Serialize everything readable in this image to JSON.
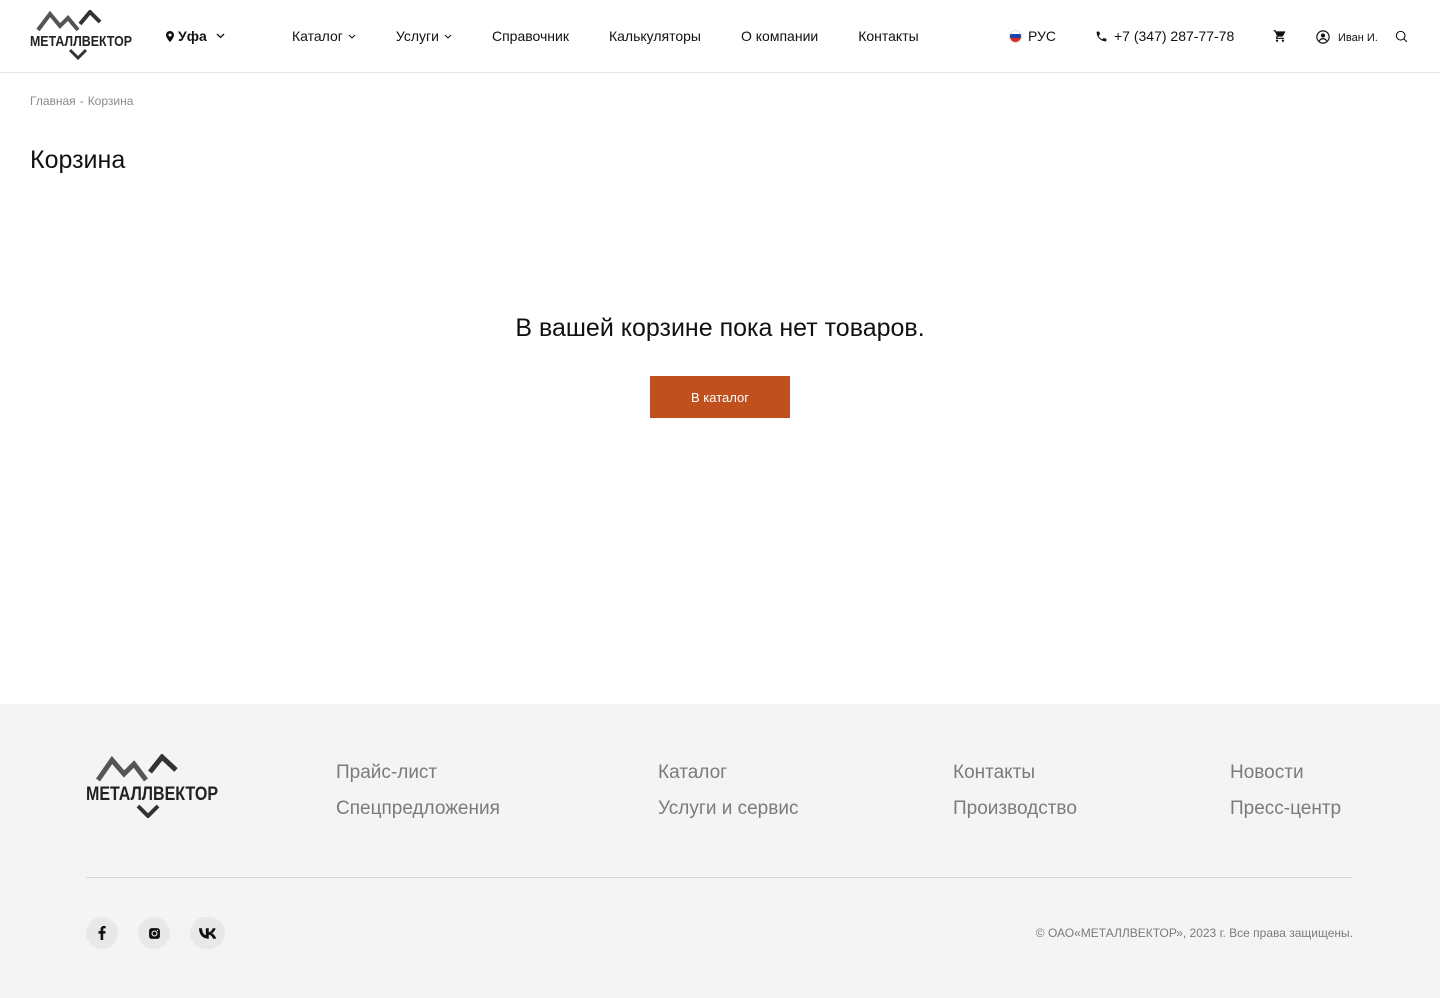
{
  "header": {
    "logo_text": "МЕТАЛЛВЕКТОР",
    "city": "Уфа",
    "nav": [
      {
        "label": "Каталог",
        "has_dropdown": true
      },
      {
        "label": "Услуги",
        "has_dropdown": true
      },
      {
        "label": "Справочник",
        "has_dropdown": false
      },
      {
        "label": "Калькуляторы",
        "has_dropdown": false
      },
      {
        "label": "О компании",
        "has_dropdown": false
      },
      {
        "label": "Контакты",
        "has_dropdown": false
      }
    ],
    "language": "РУС",
    "phone": "+7 (347) 287-77-78",
    "user_name": "Иван И."
  },
  "breadcrumb": {
    "home": "Главная",
    "separator": "-",
    "current": "Корзина"
  },
  "main": {
    "title": "Корзина",
    "empty_message": "В вашей корзине пока нет товаров.",
    "catalog_button": "В каталог"
  },
  "footer": {
    "logo_text": "МЕТАЛЛВЕКТОР",
    "columns": [
      [
        "Прайс-лист",
        "Спецпредложения"
      ],
      [
        "Каталог",
        "Услуги и сервис"
      ],
      [
        "Контакты",
        "Производство"
      ],
      [
        "Новости",
        "Пресс-центр"
      ]
    ],
    "socials": [
      "facebook-icon",
      "instagram-icon",
      "vk-icon"
    ],
    "copyright": "© ОАО«МЕТАЛЛВЕКТОР», 2023 г. Все права защищены."
  },
  "colors": {
    "accent": "#c0501e",
    "footer_bg": "#f4f4f4",
    "muted_text": "#7b7b7b"
  }
}
